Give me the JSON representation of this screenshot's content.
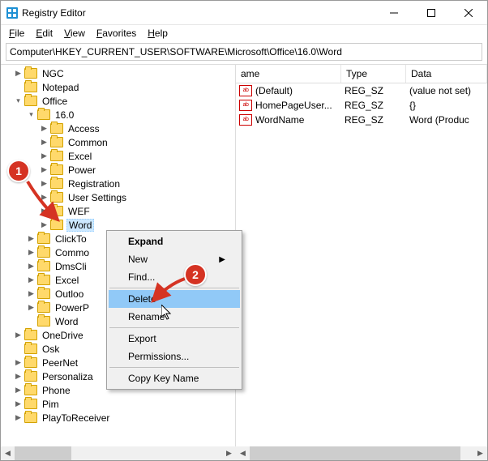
{
  "window": {
    "title": "Registry Editor"
  },
  "menu": {
    "file": "File",
    "edit": "Edit",
    "view": "View",
    "favorites": "Favorites",
    "help": "Help"
  },
  "path": "Computer\\HKEY_CURRENT_USER\\SOFTWARE\\Microsoft\\Office\\16.0\\Word",
  "tree": {
    "ngc": "NGC",
    "notepad": "Notepad",
    "office": "Office",
    "v160": "16.0",
    "access": "Access",
    "common": "Common",
    "excel": "Excel",
    "power": "Power",
    "registration": "Registration",
    "usersettings": "User Settings",
    "wef": "WEF",
    "word": "Word",
    "clickto": "ClickTo",
    "commonx": "Commo",
    "dmscli": "DmsCli",
    "excel2": "Excel",
    "outlook": "Outloo",
    "powerp": "PowerP",
    "word2": "Word",
    "onedrive": "OneDrive",
    "osk": "Osk",
    "peernet": "PeerNet",
    "personaliza": "Personaliza",
    "phone": "Phone",
    "pim": "Pim",
    "playtoreceiver": "PlayToReceiver"
  },
  "list": {
    "hdr_name": "ame",
    "hdr_type": "Type",
    "hdr_data": "Data",
    "rows": [
      {
        "name": "(Default)",
        "type": "REG_SZ",
        "data": "(value not set)"
      },
      {
        "name": "HomePageUser...",
        "type": "REG_SZ",
        "data": "{}"
      },
      {
        "name": "WordName",
        "type": "REG_SZ",
        "data": "Word (Produc"
      }
    ]
  },
  "ctx": {
    "expand": "Expand",
    "new": "New",
    "find": "Find...",
    "delete": "Delete",
    "rename": "Rename",
    "export": "Export",
    "permissions": "Permissions...",
    "copykey": "Copy Key Name"
  },
  "badges": {
    "b1": "1",
    "b2": "2"
  }
}
